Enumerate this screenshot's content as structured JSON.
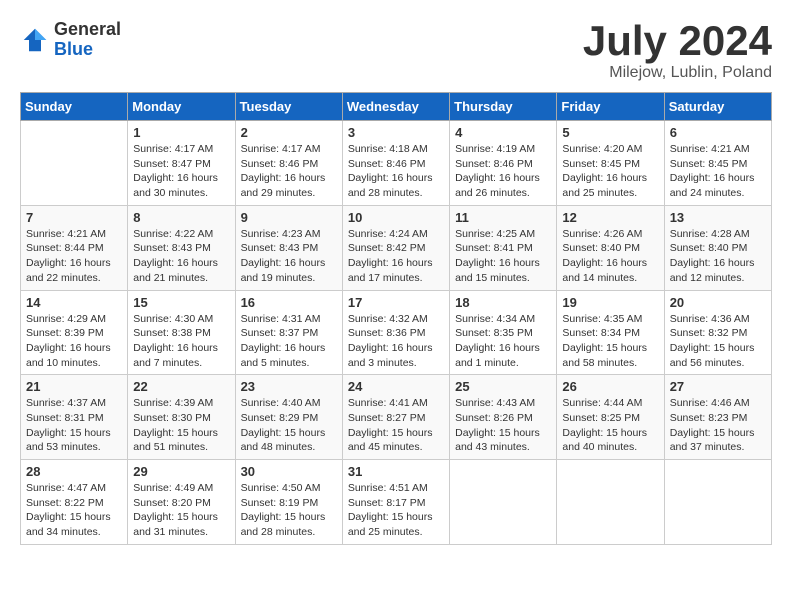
{
  "logo": {
    "general": "General",
    "blue": "Blue"
  },
  "header": {
    "title": "July 2024",
    "location": "Milejow, Lublin, Poland"
  },
  "weekdays": [
    "Sunday",
    "Monday",
    "Tuesday",
    "Wednesday",
    "Thursday",
    "Friday",
    "Saturday"
  ],
  "weeks": [
    [
      {
        "day": "",
        "info": ""
      },
      {
        "day": "1",
        "info": "Sunrise: 4:17 AM\nSunset: 8:47 PM\nDaylight: 16 hours\nand 30 minutes."
      },
      {
        "day": "2",
        "info": "Sunrise: 4:17 AM\nSunset: 8:46 PM\nDaylight: 16 hours\nand 29 minutes."
      },
      {
        "day": "3",
        "info": "Sunrise: 4:18 AM\nSunset: 8:46 PM\nDaylight: 16 hours\nand 28 minutes."
      },
      {
        "day": "4",
        "info": "Sunrise: 4:19 AM\nSunset: 8:46 PM\nDaylight: 16 hours\nand 26 minutes."
      },
      {
        "day": "5",
        "info": "Sunrise: 4:20 AM\nSunset: 8:45 PM\nDaylight: 16 hours\nand 25 minutes."
      },
      {
        "day": "6",
        "info": "Sunrise: 4:21 AM\nSunset: 8:45 PM\nDaylight: 16 hours\nand 24 minutes."
      }
    ],
    [
      {
        "day": "7",
        "info": "Sunrise: 4:21 AM\nSunset: 8:44 PM\nDaylight: 16 hours\nand 22 minutes."
      },
      {
        "day": "8",
        "info": "Sunrise: 4:22 AM\nSunset: 8:43 PM\nDaylight: 16 hours\nand 21 minutes."
      },
      {
        "day": "9",
        "info": "Sunrise: 4:23 AM\nSunset: 8:43 PM\nDaylight: 16 hours\nand 19 minutes."
      },
      {
        "day": "10",
        "info": "Sunrise: 4:24 AM\nSunset: 8:42 PM\nDaylight: 16 hours\nand 17 minutes."
      },
      {
        "day": "11",
        "info": "Sunrise: 4:25 AM\nSunset: 8:41 PM\nDaylight: 16 hours\nand 15 minutes."
      },
      {
        "day": "12",
        "info": "Sunrise: 4:26 AM\nSunset: 8:40 PM\nDaylight: 16 hours\nand 14 minutes."
      },
      {
        "day": "13",
        "info": "Sunrise: 4:28 AM\nSunset: 8:40 PM\nDaylight: 16 hours\nand 12 minutes."
      }
    ],
    [
      {
        "day": "14",
        "info": "Sunrise: 4:29 AM\nSunset: 8:39 PM\nDaylight: 16 hours\nand 10 minutes."
      },
      {
        "day": "15",
        "info": "Sunrise: 4:30 AM\nSunset: 8:38 PM\nDaylight: 16 hours\nand 7 minutes."
      },
      {
        "day": "16",
        "info": "Sunrise: 4:31 AM\nSunset: 8:37 PM\nDaylight: 16 hours\nand 5 minutes."
      },
      {
        "day": "17",
        "info": "Sunrise: 4:32 AM\nSunset: 8:36 PM\nDaylight: 16 hours\nand 3 minutes."
      },
      {
        "day": "18",
        "info": "Sunrise: 4:34 AM\nSunset: 8:35 PM\nDaylight: 16 hours\nand 1 minute."
      },
      {
        "day": "19",
        "info": "Sunrise: 4:35 AM\nSunset: 8:34 PM\nDaylight: 15 hours\nand 58 minutes."
      },
      {
        "day": "20",
        "info": "Sunrise: 4:36 AM\nSunset: 8:32 PM\nDaylight: 15 hours\nand 56 minutes."
      }
    ],
    [
      {
        "day": "21",
        "info": "Sunrise: 4:37 AM\nSunset: 8:31 PM\nDaylight: 15 hours\nand 53 minutes."
      },
      {
        "day": "22",
        "info": "Sunrise: 4:39 AM\nSunset: 8:30 PM\nDaylight: 15 hours\nand 51 minutes."
      },
      {
        "day": "23",
        "info": "Sunrise: 4:40 AM\nSunset: 8:29 PM\nDaylight: 15 hours\nand 48 minutes."
      },
      {
        "day": "24",
        "info": "Sunrise: 4:41 AM\nSunset: 8:27 PM\nDaylight: 15 hours\nand 45 minutes."
      },
      {
        "day": "25",
        "info": "Sunrise: 4:43 AM\nSunset: 8:26 PM\nDaylight: 15 hours\nand 43 minutes."
      },
      {
        "day": "26",
        "info": "Sunrise: 4:44 AM\nSunset: 8:25 PM\nDaylight: 15 hours\nand 40 minutes."
      },
      {
        "day": "27",
        "info": "Sunrise: 4:46 AM\nSunset: 8:23 PM\nDaylight: 15 hours\nand 37 minutes."
      }
    ],
    [
      {
        "day": "28",
        "info": "Sunrise: 4:47 AM\nSunset: 8:22 PM\nDaylight: 15 hours\nand 34 minutes."
      },
      {
        "day": "29",
        "info": "Sunrise: 4:49 AM\nSunset: 8:20 PM\nDaylight: 15 hours\nand 31 minutes."
      },
      {
        "day": "30",
        "info": "Sunrise: 4:50 AM\nSunset: 8:19 PM\nDaylight: 15 hours\nand 28 minutes."
      },
      {
        "day": "31",
        "info": "Sunrise: 4:51 AM\nSunset: 8:17 PM\nDaylight: 15 hours\nand 25 minutes."
      },
      {
        "day": "",
        "info": ""
      },
      {
        "day": "",
        "info": ""
      },
      {
        "day": "",
        "info": ""
      }
    ]
  ]
}
